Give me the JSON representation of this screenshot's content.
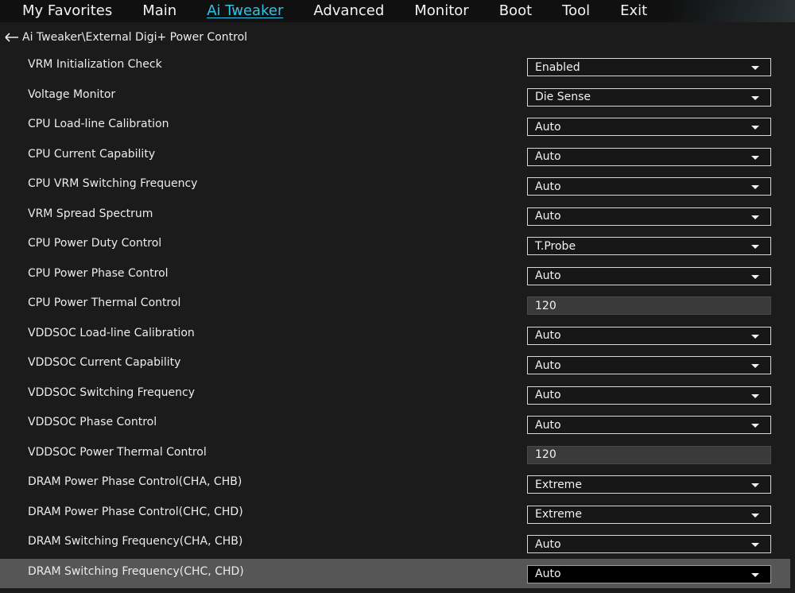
{
  "nav": {
    "tabs": [
      {
        "label": "My Favorites"
      },
      {
        "label": "Main"
      },
      {
        "label": "Ai Tweaker"
      },
      {
        "label": "Advanced"
      },
      {
        "label": "Monitor"
      },
      {
        "label": "Boot"
      },
      {
        "label": "Tool"
      },
      {
        "label": "Exit"
      }
    ],
    "active_tab": "Ai Tweaker"
  },
  "breadcrumb": {
    "path": "Ai Tweaker\\External Digi+ Power Control"
  },
  "settings": [
    {
      "label": "VRM Initialization Check",
      "value": "Enabled",
      "type": "dropdown"
    },
    {
      "label": "Voltage Monitor",
      "value": "Die Sense",
      "type": "dropdown"
    },
    {
      "label": "CPU Load-line Calibration",
      "value": "Auto",
      "type": "dropdown"
    },
    {
      "label": "CPU Current Capability",
      "value": "Auto",
      "type": "dropdown"
    },
    {
      "label": "CPU VRM Switching Frequency",
      "value": "Auto",
      "type": "dropdown"
    },
    {
      "label": "VRM Spread Spectrum",
      "value": "Auto",
      "type": "dropdown"
    },
    {
      "label": "CPU Power Duty Control",
      "value": "T.Probe",
      "type": "dropdown"
    },
    {
      "label": "CPU Power Phase Control",
      "value": "Auto",
      "type": "dropdown"
    },
    {
      "label": "CPU Power Thermal Control",
      "value": "120",
      "type": "input"
    },
    {
      "label": "VDDSOC Load-line Calibration",
      "value": "Auto",
      "type": "dropdown"
    },
    {
      "label": "VDDSOC Current Capability",
      "value": "Auto",
      "type": "dropdown"
    },
    {
      "label": "VDDSOC Switching Frequency",
      "value": "Auto",
      "type": "dropdown"
    },
    {
      "label": "VDDSOC Phase Control",
      "value": "Auto",
      "type": "dropdown"
    },
    {
      "label": "VDDSOC Power Thermal Control",
      "value": "120",
      "type": "input"
    },
    {
      "label": "DRAM Power Phase Control(CHA, CHB)",
      "value": "Extreme",
      "type": "dropdown"
    },
    {
      "label": "DRAM Power Phase Control(CHC, CHD)",
      "value": "Extreme",
      "type": "dropdown"
    },
    {
      "label": "DRAM Switching Frequency(CHA, CHB)",
      "value": "Auto",
      "type": "dropdown"
    },
    {
      "label": "DRAM Switching Frequency(CHC, CHD)",
      "value": "Auto",
      "type": "dropdown",
      "selected": true
    }
  ],
  "colors": {
    "accent": "#2ec4e6",
    "background": "#1b1b1b",
    "selected_row": "#565656"
  }
}
